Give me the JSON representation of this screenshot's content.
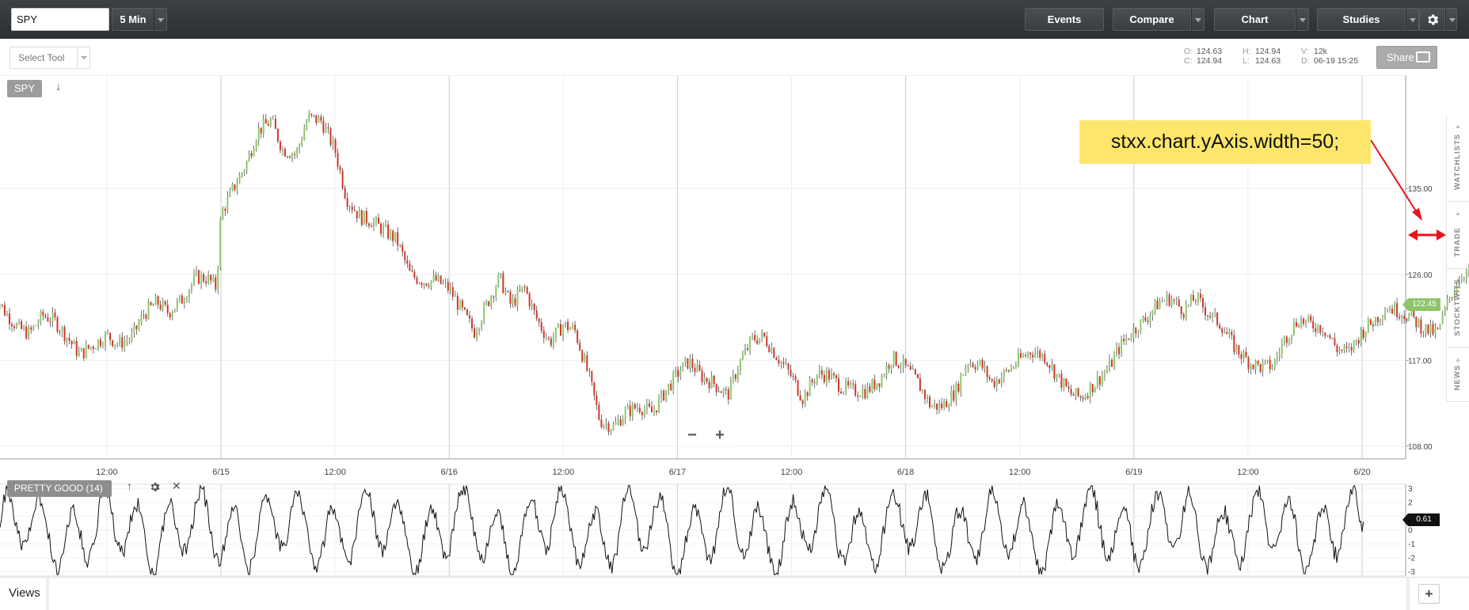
{
  "toolbar": {
    "symbol": "SPY",
    "interval": "5 Min",
    "buttons": {
      "events": "Events",
      "compare": "Compare",
      "chart": "Chart",
      "studies": "Studies"
    },
    "settings_icon": "gear-icon"
  },
  "subbar": {
    "select_tool": "Select Tool",
    "hud": {
      "open_key": "O:",
      "open": "124.63",
      "close_key": "C:",
      "close": "124.94",
      "high_key": "H:",
      "high": "124.94",
      "low_key": "L:",
      "low": "124.63",
      "volume_key": "V:",
      "volume": "12k",
      "date_key": "D:",
      "date": "06-19 15:25"
    },
    "share": "Share"
  },
  "chart": {
    "symbol_tag": "SPY",
    "annotation": "stxx.chart.yAxis.width=50;",
    "current_price": "122.45",
    "zoom_out": "−",
    "zoom_in": "+",
    "annotation_arrow_color": "#e8131b",
    "annotation_bg": "#fde66b",
    "up_color": "#8ec86a",
    "down_color": "#d1362a"
  },
  "study": {
    "label": "PRETTY GOOD (14)",
    "current_value": "0.61",
    "up_icon": "↑",
    "close_icon": "✕"
  },
  "sidebar": {
    "tabs": [
      "WATCHLISTS",
      "TRADE",
      "STOCKTWITS",
      "NEWS"
    ]
  },
  "bottom": {
    "views": "Views",
    "add": "+"
  },
  "chart_data": {
    "type": "candlestick",
    "title": "",
    "xlabel": "",
    "ylabel": "",
    "x_tick_labels": [
      "12:00",
      "6/15",
      "12:00",
      "6/16",
      "12:00",
      "6/17",
      "12:00",
      "6/18",
      "12:00",
      "6/19",
      "12:00",
      "6/20"
    ],
    "y_tick_labels": [
      "135.00",
      "126.00",
      "117.00",
      "108.00"
    ],
    "y_ticks": [
      135,
      126,
      117,
      108
    ],
    "ylim": [
      107.5,
      144.8
    ],
    "series": [
      {
        "name": "SPY",
        "x": [
          0,
          0.05,
          0.11,
          0.16,
          0.22,
          0.27,
          0.33,
          0.38,
          0.44,
          0.5,
          0.55,
          0.61,
          0.66,
          0.72,
          0.77,
          0.83,
          0.89,
          0.94,
          0.98,
          1.0,
          1.05,
          1.11,
          1.16,
          1.22,
          1.27,
          1.33,
          1.38,
          1.44,
          1.5,
          1.55,
          1.61,
          1.66,
          1.72,
          1.77,
          1.83,
          1.89,
          1.94,
          2.0,
          2.05,
          2.11,
          2.16,
          2.22,
          2.27,
          2.33,
          2.38,
          2.44,
          2.5,
          2.55,
          2.61,
          2.66,
          2.72,
          2.77,
          2.83,
          2.89,
          2.94,
          3.0,
          3.05,
          3.11,
          3.16,
          3.22,
          3.27,
          3.33,
          3.38,
          3.44,
          3.5,
          3.55,
          3.61,
          3.66,
          3.72,
          3.77,
          3.83,
          3.89,
          3.94,
          4.0,
          4.05,
          4.11,
          4.16,
          4.22,
          4.27,
          4.33,
          4.38,
          4.44,
          4.5,
          4.55,
          4.61,
          4.66,
          4.72,
          4.77,
          4.83,
          4.89,
          4.94,
          5.0,
          5.05,
          5.11,
          5.16,
          5.22,
          5.27,
          5.33,
          5.38,
          5.44,
          5.5,
          5.55,
          5.61,
          5.66,
          5.72,
          5.77,
          5.83,
          5.89,
          5.94,
          6.0,
          6.05,
          6.11,
          6.16,
          6.22,
          6.27,
          6.33,
          6.38,
          6.44,
          6.5,
          6.55,
          6.61,
          6.66,
          6.72,
          6.77,
          6.83,
          6.89,
          6.94,
          6.98
        ],
        "close": [
          124.3,
          122.2,
          120.4,
          119.8,
          121.7,
          121.2,
          119.3,
          117.6,
          118.6,
          119.6,
          118.7,
          119.4,
          121.8,
          123.1,
          122.0,
          123.4,
          125.7,
          125.6,
          124.6,
          132.3,
          134.8,
          137.5,
          141.0,
          142.1,
          139.1,
          138.6,
          142.4,
          142.1,
          139.0,
          134.0,
          132.0,
          131.6,
          130.5,
          129.6,
          125.9,
          125.3,
          125.4,
          124.5,
          122.4,
          120.0,
          122.6,
          125.7,
          122.8,
          124.6,
          121.5,
          118.9,
          120.7,
          120.2,
          115.5,
          110.7,
          110.0,
          111.5,
          112.2,
          111.5,
          113.5,
          115.6,
          116.9,
          115.2,
          114.6,
          113.3,
          116.6,
          119.3,
          119.4,
          117.3,
          115.3,
          113.0,
          115.5,
          115.5,
          114.2,
          113.8,
          113.8,
          115.1,
          117.3,
          116.2,
          114.8,
          112.2,
          112.2,
          113.8,
          116.9,
          116.5,
          114.6,
          115.7,
          117.1,
          118.0,
          117.4,
          115.5,
          113.5,
          113.1,
          114.6,
          116.2,
          118.5,
          120.2,
          121.3,
          123.1,
          123.5,
          122.2,
          123.6,
          121.8,
          120.8,
          118.4,
          116.9,
          116.3,
          116.4,
          119.2,
          121.3,
          120.8,
          120.4,
          118.2,
          117.8,
          120.0,
          121.1,
          122.6,
          122.2,
          121.4,
          120.3,
          119.8,
          123.4,
          126.2,
          126.0,
          124.0,
          123.7,
          126.1,
          125.5,
          120.7,
          119.8,
          119.6,
          123.9,
          122.5
        ]
      },
      {
        "name": "PRETTY GOOD (14)",
        "y_tick_labels": [
          "3",
          "2",
          "1",
          "0",
          "-1",
          "-2",
          "-3"
        ],
        "ylim": [
          -3.3,
          3.3
        ],
        "last_value": 0.61
      }
    ]
  }
}
